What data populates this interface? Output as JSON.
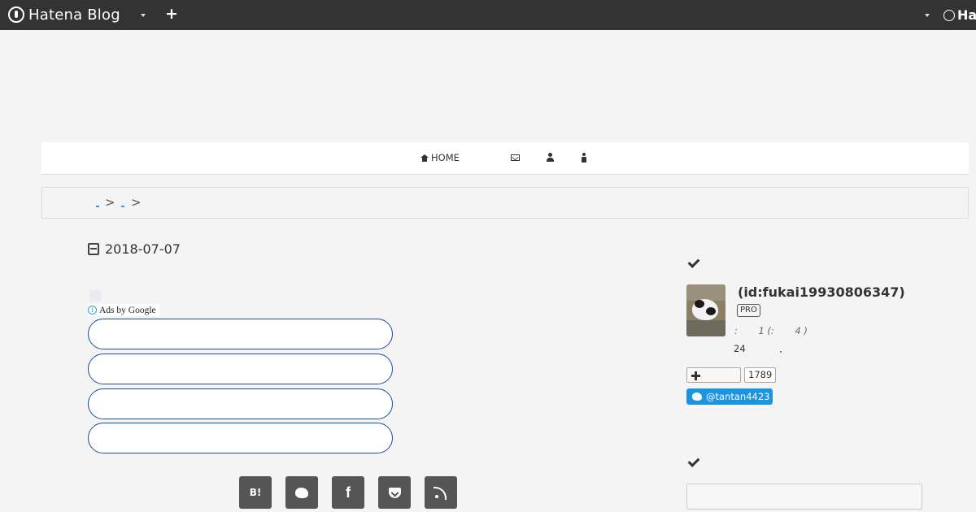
{
  "topbar": {
    "brand": "Hatena Blog",
    "right_brand": "Ha"
  },
  "nav": {
    "home_label": "HOME"
  },
  "breadcrumb": {
    "separators": [
      ">",
      ">"
    ]
  },
  "entry": {
    "date": "2018-07-07",
    "ads_label": "Ads by Google",
    "ad_items": [
      "",
      "",
      "",
      ""
    ],
    "share_buttons": [
      "hatena-bookmark",
      "twitter",
      "facebook",
      "pocket",
      "rss"
    ],
    "hatena_bookmark_label": "B!",
    "facebook_label": "f"
  },
  "sidebar": {
    "profile": {
      "id_text": "(id:fukai19930806347)",
      "pro_badge": "PRO",
      "meta_text": ":       1 (:       4 )",
      "count_text": "24",
      "follower_count": "1789",
      "twitter_handle": "@tantan4423"
    }
  },
  "colors": {
    "topbar": "#333333",
    "accent_link": "#3a9bd5",
    "ad_border": "#1a4ea0",
    "twitter": "#1b95e0",
    "share_button": "#555555"
  }
}
